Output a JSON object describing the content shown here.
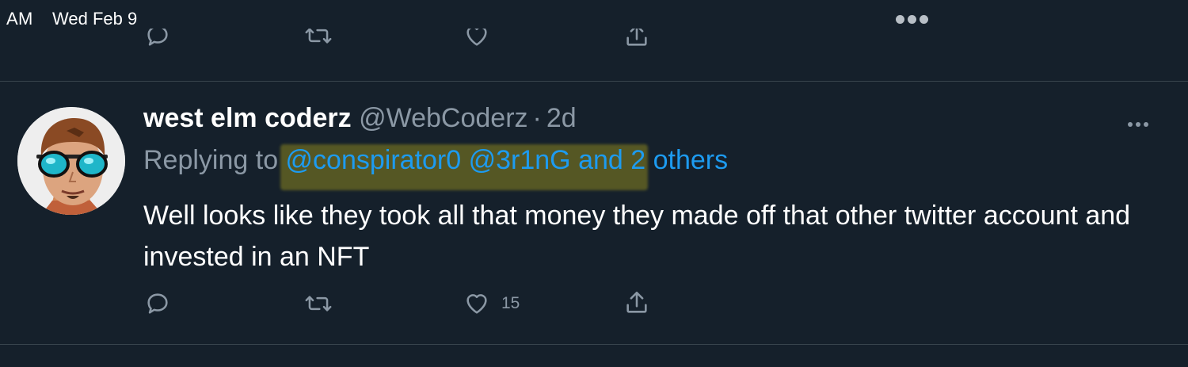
{
  "status_bar": {
    "time": "AM",
    "date": "Wed Feb 9"
  },
  "icons": {
    "status_more": "more-dots-icon",
    "reply": "reply-icon",
    "retweet": "retweet-icon",
    "like": "heart-icon",
    "share": "share-icon",
    "tweet_more": "more-horizontal-icon"
  },
  "tweet": {
    "display_name": "west elm coderz",
    "handle": "@WebCoderz",
    "separator": "·",
    "timestamp": "2d",
    "replying_prefix": "Replying to ",
    "replying_mentions": "@conspirator0 @3r1nG and 2 others",
    "text": "Well looks like they took all that money they made off that other twitter account and invested in an NFT",
    "like_count": "15"
  },
  "colors": {
    "background": "#15202b",
    "divider": "#38444d",
    "muted": "#8b98a5",
    "mention": "#1d9bf0",
    "highlight": "#6b6a22"
  }
}
